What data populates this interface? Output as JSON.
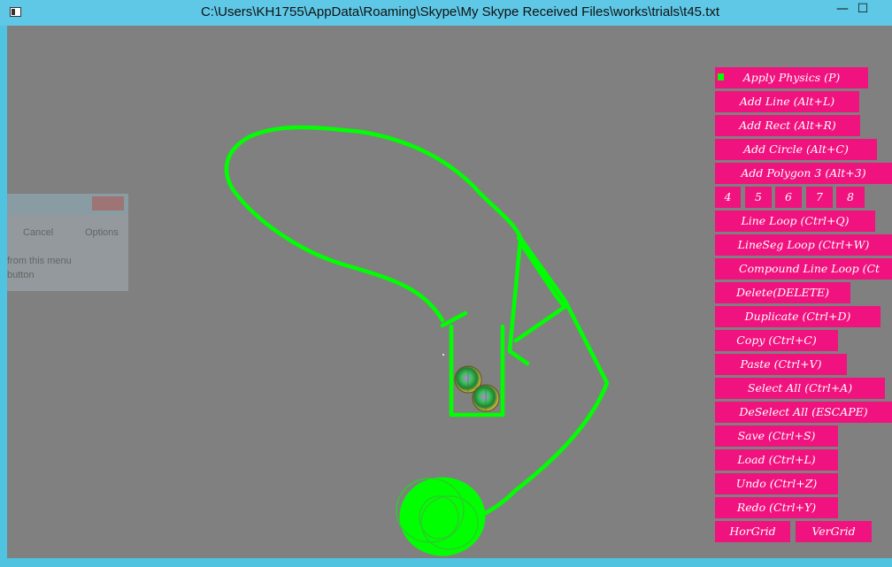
{
  "window": {
    "title": "C:\\Users\\KH1755\\AppData\\Roaming\\Skype\\My Skype Received Files\\works\\trials\\t45.txt",
    "minimize_glyph": "—",
    "maximize_glyph": "☐"
  },
  "background_dialog": {
    "cancel": "Cancel",
    "options": "Options",
    "line1": "from this menu",
    "line2": "button"
  },
  "colors": {
    "canvas": "#808080",
    "button": "#f0127e",
    "shape": "#00ff00",
    "titlebar": "#5ec8e6"
  },
  "toolbar": {
    "apply_physics": "Apply Physics (P)",
    "add_line": "Add Line (Alt+L)",
    "add_rect": "Add Rect (Alt+R)",
    "add_circle": "Add Circle (Alt+C)",
    "add_polygon3": "Add Polygon 3 (Alt+3)",
    "poly4": "4",
    "poly5": "5",
    "poly6": "6",
    "poly7": "7",
    "poly8": "8",
    "line_loop": "Line Loop (Ctrl+Q)",
    "lineseg_loop": "LineSeg Loop (Ctrl+W)",
    "compound_line_loop": "Compound Line Loop (Ct",
    "delete": "Delete(DELETE)",
    "duplicate": "Duplicate (Ctrl+D)",
    "copy": "Copy (Ctrl+C)",
    "paste": "Paste (Ctrl+V)",
    "select_all": "Select All (Ctrl+A)",
    "deselect_all": "DeSelect All (ESCAPE)",
    "save": "Save (Ctrl+S)",
    "load": "Load (Ctrl+L)",
    "undo": "Undo (Ctrl+Z)",
    "redo": "Redo (Ctrl+Y)",
    "hor_grid": "HorGrid",
    "ver_grid": "VerGrid"
  }
}
